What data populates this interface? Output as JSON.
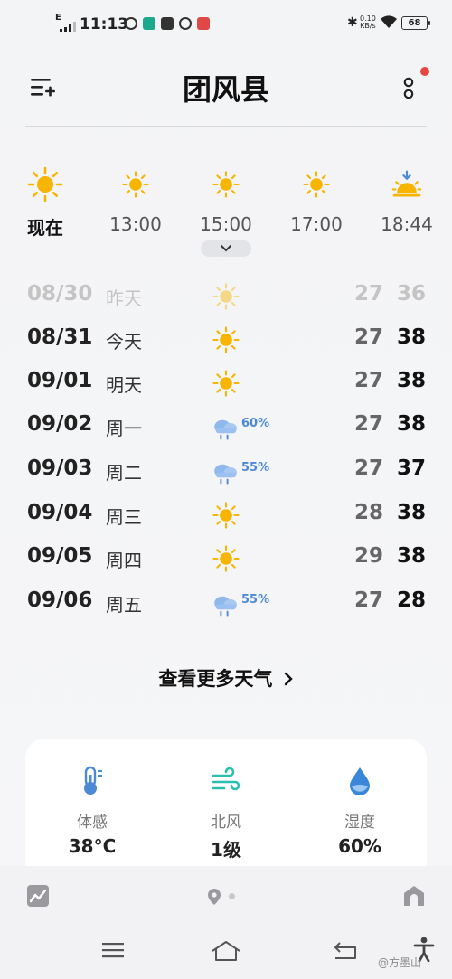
{
  "status_bar": {
    "signal_label": "E",
    "time": "11:13",
    "net_speed_value": "0.10",
    "net_speed_unit": "KB/s",
    "battery": "68"
  },
  "header": {
    "title": "团风县"
  },
  "hourly": [
    {
      "label": "现在",
      "icon": "sun-icon"
    },
    {
      "label": "13:00",
      "icon": "sun-icon"
    },
    {
      "label": "15:00",
      "icon": "sun-icon"
    },
    {
      "label": "17:00",
      "icon": "sun-icon"
    },
    {
      "label": "18:44",
      "icon": "sunset-icon"
    }
  ],
  "daily": [
    {
      "date": "08/30",
      "day": "昨天",
      "icon": "sun-icon",
      "precip": "",
      "low": "27",
      "high": "36"
    },
    {
      "date": "08/31",
      "day": "今天",
      "icon": "sun-icon",
      "precip": "",
      "low": "27",
      "high": "38"
    },
    {
      "date": "09/01",
      "day": "明天",
      "icon": "sun-icon",
      "precip": "",
      "low": "27",
      "high": "38"
    },
    {
      "date": "09/02",
      "day": "周一",
      "icon": "rain-cloud-icon",
      "precip": "60%",
      "low": "27",
      "high": "38"
    },
    {
      "date": "09/03",
      "day": "周二",
      "icon": "rain-cloud-icon",
      "precip": "55%",
      "low": "27",
      "high": "37"
    },
    {
      "date": "09/04",
      "day": "周三",
      "icon": "sun-icon",
      "precip": "",
      "low": "28",
      "high": "38"
    },
    {
      "date": "09/05",
      "day": "周四",
      "icon": "sun-icon",
      "precip": "",
      "low": "29",
      "high": "38"
    },
    {
      "date": "09/06",
      "day": "周五",
      "icon": "rain-cloud-icon",
      "precip": "55%",
      "low": "27",
      "high": "28"
    }
  ],
  "more_link": "查看更多天气",
  "stats": [
    {
      "label": "体感",
      "value": "38°C",
      "icon": "thermometer-icon"
    },
    {
      "label": "北风",
      "value": "1级",
      "icon": "wind-icon"
    },
    {
      "label": "湿度",
      "value": "60%",
      "icon": "humidity-drop-icon"
    }
  ],
  "watermark": "@方墨山",
  "colors": {
    "sun": "#f7b500",
    "rain_accent": "#4d8ad6",
    "wind": "#2bbfb0",
    "notification_dot": "#e84545"
  }
}
